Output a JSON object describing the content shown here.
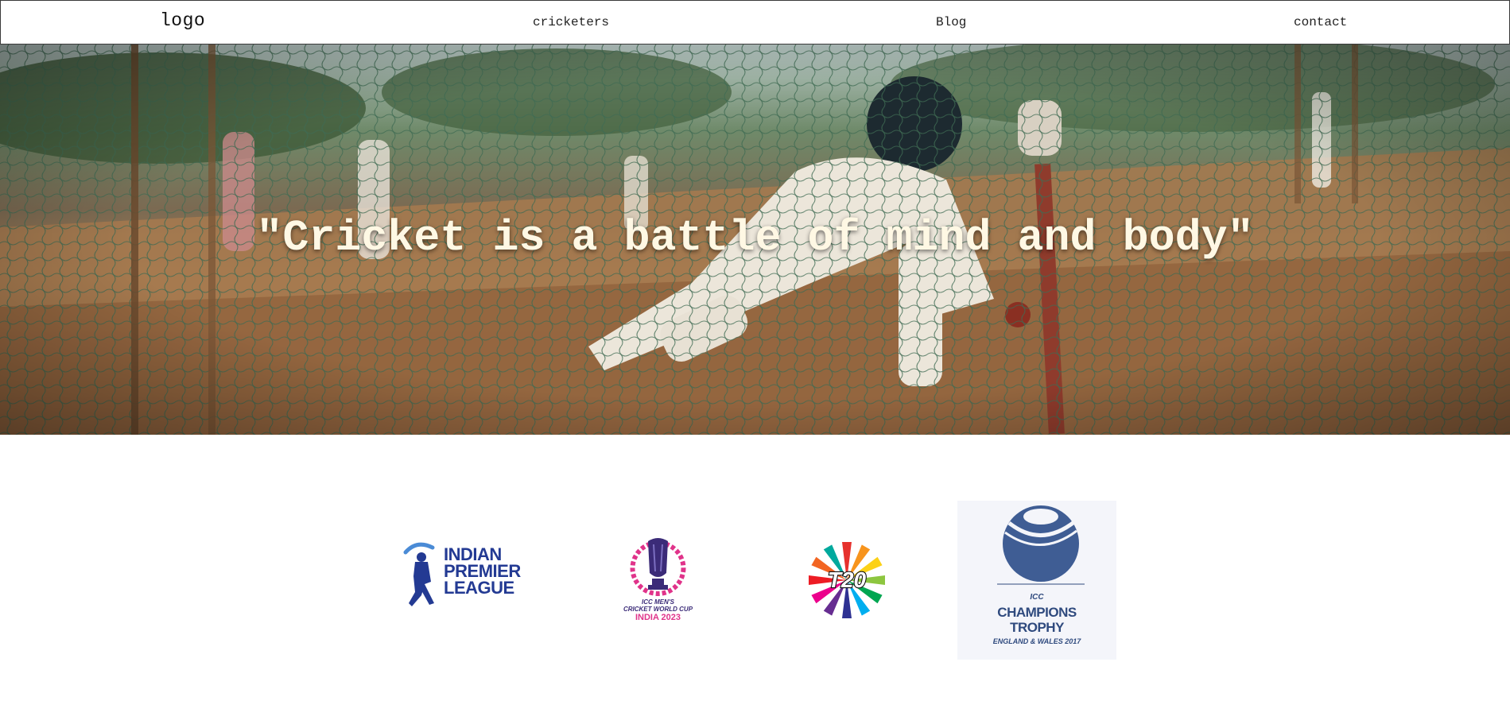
{
  "nav": {
    "logo": "logo",
    "links": [
      "cricketers",
      "Blog",
      "contact"
    ]
  },
  "hero": {
    "quote": "\"Cricket is a battle of mind and body\"",
    "image": "batsman-in-practice-nets-photo"
  },
  "logos": {
    "ipl": {
      "lines": [
        "INDIAN",
        "PREMIER",
        "LEAGUE"
      ],
      "icon": "ipl-batsman-logo"
    },
    "world_cup": {
      "line1": "ICC MEN'S",
      "line2": "CRICKET WORLD CUP",
      "line3": "INDIA 2023",
      "icon": "world-cup-trophy-logo"
    },
    "t20": {
      "text": "T20",
      "icon": "t20-burst-logo"
    },
    "champions_trophy": {
      "icc": "ICC",
      "line1": "CHAMPIONS",
      "line2": "TROPHY",
      "line3": "ENGLAND & WALES 2017",
      "icon": "champions-trophy-ball-logo"
    }
  },
  "colors": {
    "quote_text": "#fff8e4",
    "ipl_blue": "#233a93",
    "wc_pink": "#e0338a",
    "ct_navy": "#2f4a7e"
  }
}
